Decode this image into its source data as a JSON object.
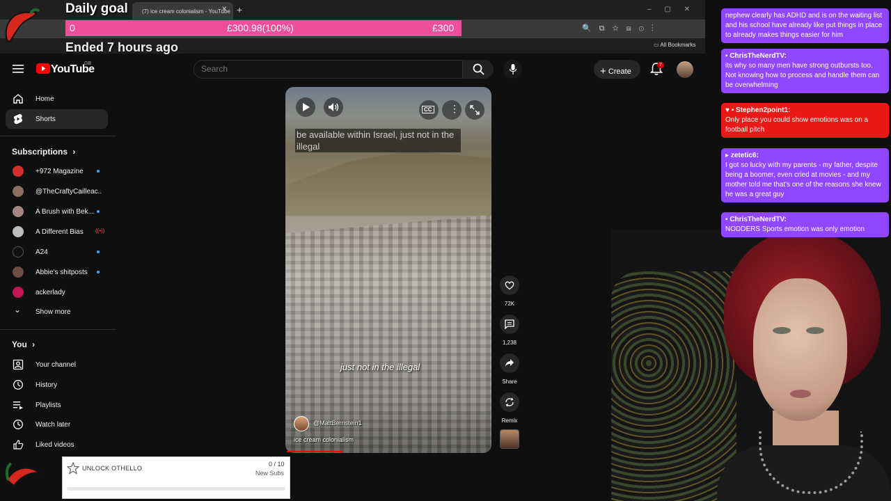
{
  "browser": {
    "tab_title": "(7) ice cream colonialism - YouTube",
    "bookmarks_label": "All Bookmarks"
  },
  "goal": {
    "title": "Daily goal",
    "start": "0",
    "current": "£300.98(100%)",
    "target": "£300",
    "status": "Ended 7 hours ago",
    "progress_fraction": 1.0,
    "color": "#ef4f98"
  },
  "youtube": {
    "logo": "YouTube",
    "region": "GB",
    "search_placeholder": "Search",
    "create_label": "Create",
    "notification_count": "7",
    "sidebar": {
      "home": "Home",
      "shorts": "Shorts",
      "subscriptions_title": "Subscriptions",
      "subscriptions": [
        {
          "label": "+972 Magazine",
          "color": "#d32f2f",
          "indicator": "dot"
        },
        {
          "label": "@TheCraftyCailleac...",
          "color": "#8d6e63",
          "indicator": "none"
        },
        {
          "label": "A Brush with Bek...",
          "color": "#a1887f",
          "indicator": "dot"
        },
        {
          "label": "A Different Bias",
          "color": "#bdbdbd",
          "indicator": "live"
        },
        {
          "label": "A24",
          "color": "#111111",
          "indicator": "dot"
        },
        {
          "label": "Abbie's shitposts",
          "color": "#6d4c41",
          "indicator": "dot"
        },
        {
          "label": "ackerlady",
          "color": "#c2185b",
          "indicator": "none"
        }
      ],
      "show_more": "Show more",
      "you_title": "You",
      "you_items": [
        "Your channel",
        "History",
        "Playlists",
        "Watch later",
        "Liked videos"
      ]
    },
    "short": {
      "caption_top": "be available within Israel, just not in the illegal",
      "caption_mid": "just not in the illegal",
      "channel": "@MattBernstein1",
      "title": "ice cream colonialism",
      "cc_label": "CC",
      "likes": "72K",
      "comments": "1,238",
      "share": "Share",
      "remix": "Remix"
    }
  },
  "chat": [
    {
      "user": "",
      "text": "nephew clearly has ADHD and is on the waiting list and his school have already like put things in place to already makes things easier for him",
      "color": "purple"
    },
    {
      "user": "ChrisTheNerdTV:",
      "text": "its why so many men have strong outbursts too. Not knowing how to process and handle them can be overwhelming",
      "color": "purple"
    },
    {
      "user": "Stephen2point1:",
      "text": "Only place you could show emotions was on a football pitch",
      "color": "red"
    },
    {
      "user": "zetetic6:",
      "text": "I got so lucky with my parents - my father, despite being a boomer, even cried at movies - and my mother told me that's one of the reasons she knew he was a great guy",
      "color": "purple"
    },
    {
      "user": "ChrisTheNerdTV:",
      "text": "NODDERS Sports emotion was only emotion",
      "color": "purple"
    }
  ],
  "unlock": {
    "label": "UNLOCK OTHELLO",
    "count": "0 / 10",
    "sub_label": "New Subs",
    "progress_fraction": 0
  },
  "colors": {
    "chat_purple": "#9146ff",
    "chat_red": "#e91916",
    "yt_red": "#ff0000"
  }
}
